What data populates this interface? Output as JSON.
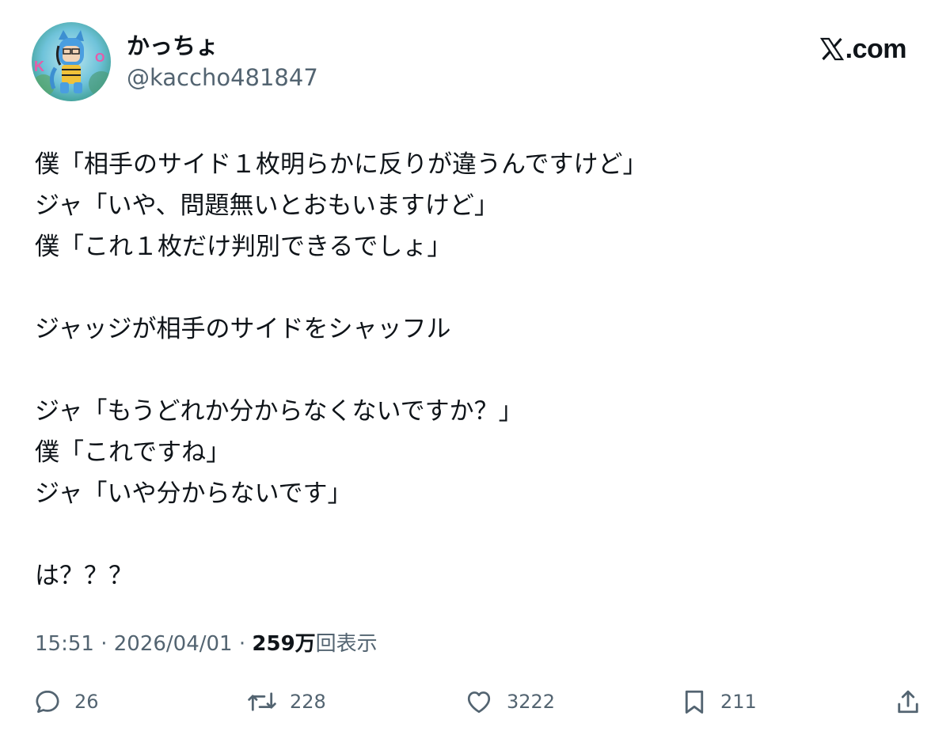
{
  "author": {
    "display_name": "かっちょ",
    "handle": "@kaccho481847"
  },
  "brand": {
    "label": ".com"
  },
  "tweet": {
    "lines": [
      "僕「相手のサイド１枚明らかに反りが違うんですけど」",
      "ジャ「いや、問題無いとおもいますけど」",
      "僕「これ１枚だけ判別できるでしょ」",
      "",
      "ジャッジが相手のサイドをシャッフル",
      "",
      "ジャ「もうどれか分からなくないですか？」",
      "僕「これですね」",
      "ジャ「いや分からないです」",
      "",
      "は？？？"
    ]
  },
  "meta": {
    "time": "15:51",
    "separator": "·",
    "date": "2026/04/01",
    "views_count": "259万",
    "views_label": "回表示"
  },
  "actions": {
    "reply": {
      "icon": "reply-icon",
      "count": "26"
    },
    "repost": {
      "icon": "repost-icon",
      "count": "228"
    },
    "like": {
      "icon": "heart-icon",
      "count": "3222"
    },
    "bookmark": {
      "icon": "bookmark-icon",
      "count": "211"
    },
    "share": {
      "icon": "share-icon"
    }
  },
  "colors": {
    "text_primary": "#0f1419",
    "text_secondary": "#536471",
    "background": "#ffffff"
  }
}
